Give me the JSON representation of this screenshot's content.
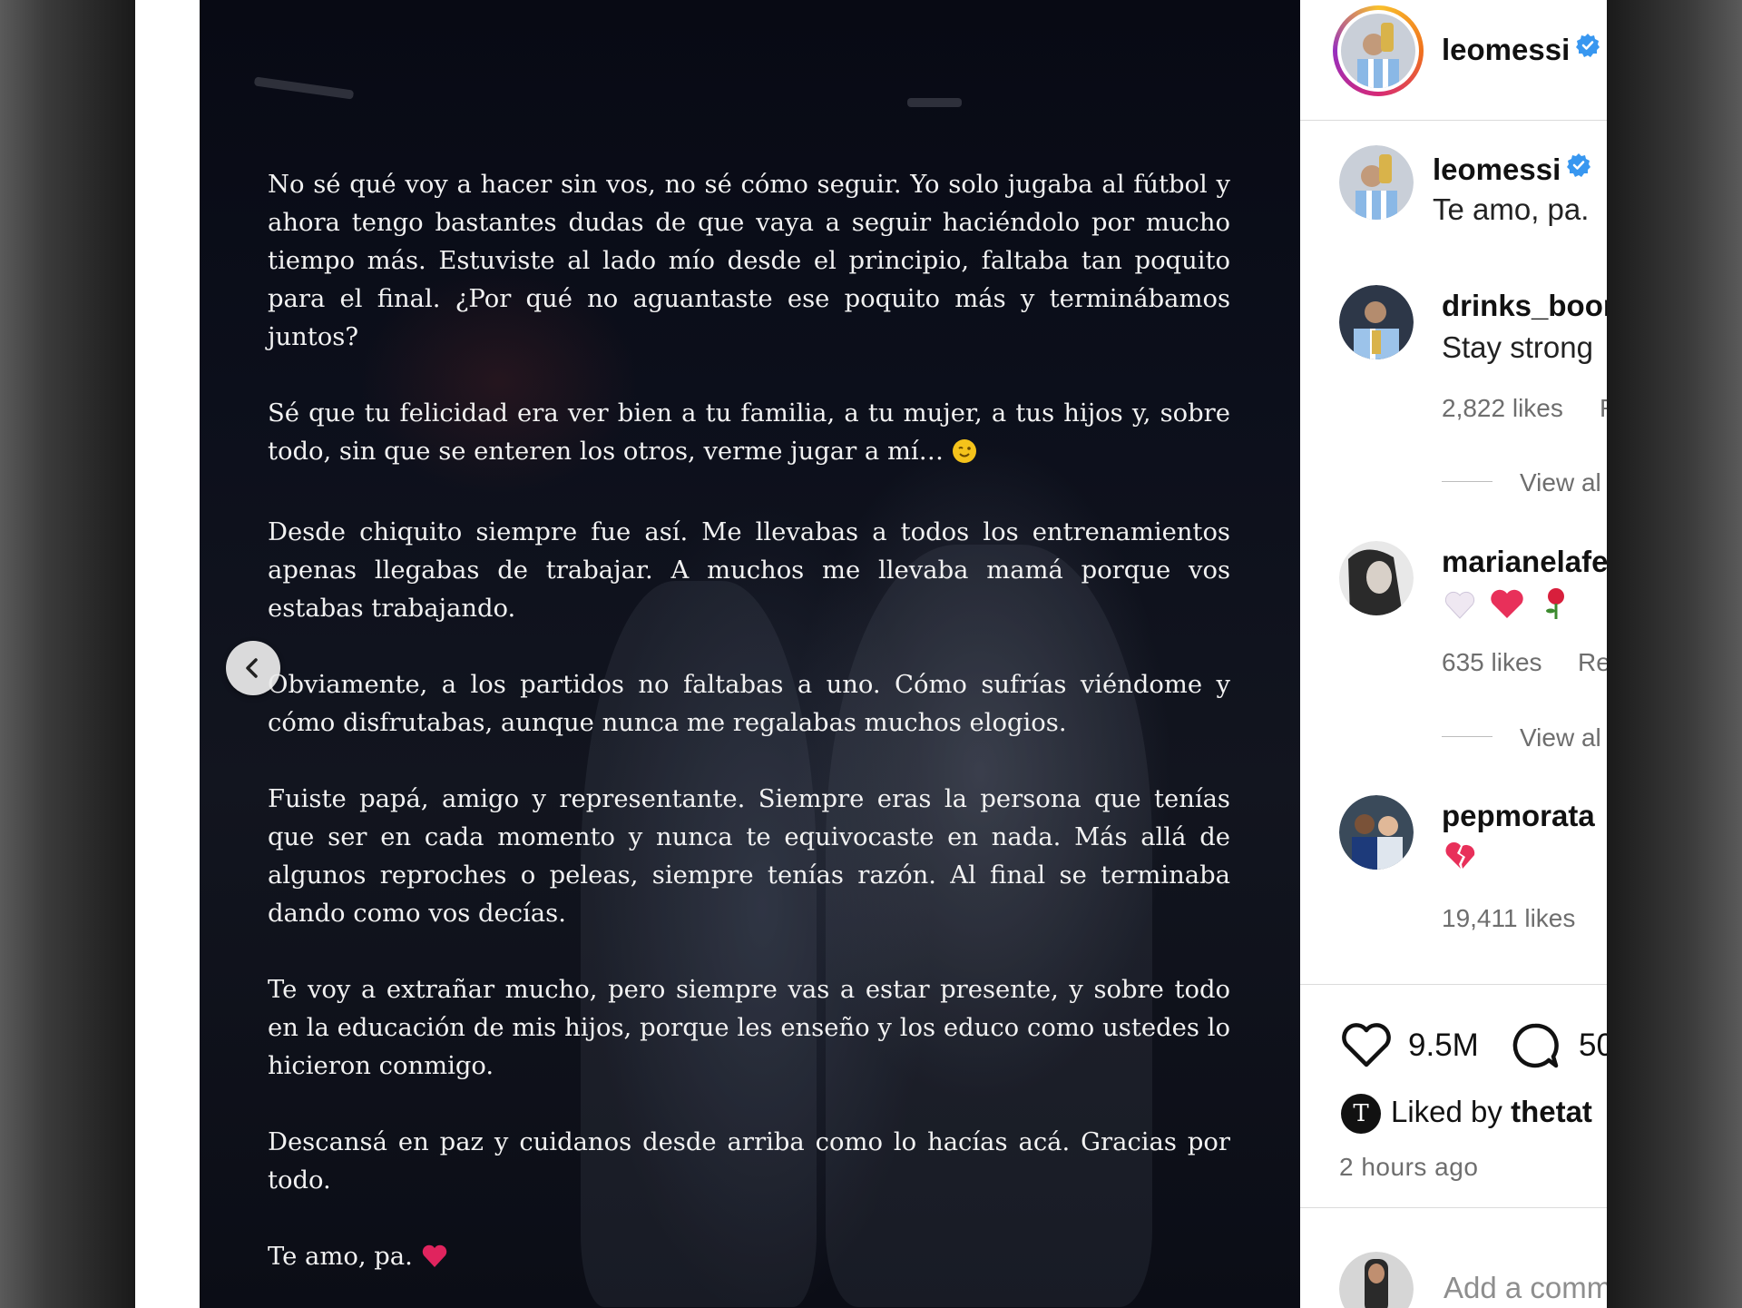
{
  "post": {
    "paragraphs": [
      "No sé qué voy a hacer sin vos, no sé cómo seguir. Yo solo jugaba al fútbol y ahora tengo bastantes dudas de que vaya a seguir haciéndolo por mucho tiempo más. Estuviste al lado mío desde el principio, faltaba tan poquito para el final. ¿Por qué no aguantaste ese poquito más y terminábamos juntos?",
      "Sé que tu felicidad era ver bien a tu familia, a tu mujer, a tus hijos y, sobre todo, sin que se enteren los otros, verme jugar a mí…",
      "Desde chiquito siempre fue así. Me llevabas a todos los entrenamientos apenas llegabas de trabajar. A muchos me llevaba mamá porque vos estabas trabajando.",
      "Obviamente, a los partidos no faltabas a uno. Cómo sufrías viéndome y cómo disfrutabas, aunque nunca me regalabas muchos elogios.",
      "Fuiste papá, amigo y representante. Siempre eras la persona que tenías que ser en cada momento y nunca te equivocaste en nada. Más allá de algunos reproches o peleas, siempre tenías razón. Al final se terminaba dando como vos decías.",
      "Te voy a extrañar mucho, pero siempre vas a estar presente, y sobre todo en la educación de mis hijos, porque les enseño y los educo como ustedes lo hicieron conmigo.",
      "Descansá en paz y cuidanos desde arriba como lo hacías acá. Gracias por todo.",
      "Te amo, pa."
    ],
    "emoji_wink": "wink-emoji",
    "emoji_heart": "heart-emoji"
  },
  "header": {
    "username": "leomessi"
  },
  "caption": {
    "username": "leomessi",
    "text": "Te amo, pa."
  },
  "comments": [
    {
      "username": "drinks_boor",
      "text": "Stay strong",
      "likes": "2,822 likes",
      "reply": "R",
      "view_replies": "View al"
    },
    {
      "username": "marianelafe",
      "text": "",
      "likes": "635 likes",
      "reply": "Re",
      "view_replies": "View al"
    },
    {
      "username": "pepmorata",
      "text": "",
      "likes": "19,411 likes",
      "reply": "",
      "view_replies": ""
    }
  ],
  "actions": {
    "like_count": "9.5M",
    "comment_count": "50",
    "liked_by_prefix": "Liked by ",
    "liked_by_user": "thetat",
    "time": "2 hours ago",
    "add_comment_placeholder": "Add a comm"
  },
  "colors": {
    "verified": "#3897f0",
    "heart_red": "#e0245e",
    "ring": [
      "#f9c12d",
      "#f0711c",
      "#d62976",
      "#962fbf"
    ]
  }
}
